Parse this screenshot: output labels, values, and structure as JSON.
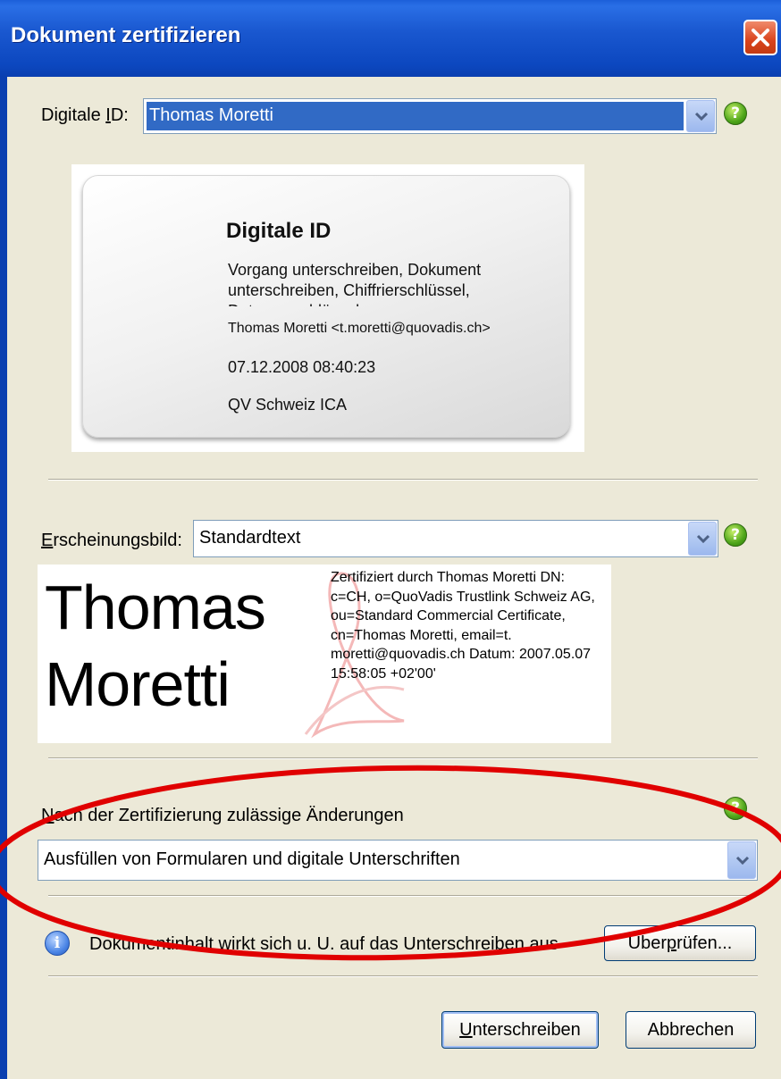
{
  "window": {
    "title": "Dokument zertifizieren"
  },
  "digital_id": {
    "label_pre": "Digitale ",
    "label_accel": "I",
    "label_post": "D:",
    "selected": "Thomas Moretti"
  },
  "id_card": {
    "title": "Digitale ID",
    "usage": "Vorgang unterschreiben, Dokument unterschreiben, Chiffrierschlüssel, Datenverschlüsselung",
    "owner": "Thomas Moretti <t.moretti@quovadis.ch>",
    "date": "07.12.2008 08:40:23",
    "issuer": "QV Schweiz ICA"
  },
  "appearance": {
    "label_accel": "E",
    "label_rest": "rscheinungsbild:",
    "selected": "Standardtext",
    "preview_name_line1": "Thomas",
    "preview_name_line2": "Moretti",
    "preview_details": "Zertifiziert durch Thomas Moretti DN: c=CH, o=QuoVadis Trustlink Schweiz AG, ou=Standard Commercial Certificate, cn=Thomas Moretti, email=t. moretti@quovadis.ch Datum: 2007.05.07 15:58:05 +02'00'"
  },
  "permissions": {
    "label_accel": "N",
    "label_rest": "ach der Zertifizierung zulässige Änderungen",
    "selected": "Ausfüllen von Formularen und digitale Unterschriften"
  },
  "info": {
    "text": "Dokumentinhalt wirkt sich u. U. auf das Unterschreiben aus",
    "review_button_pre": "Über",
    "review_button_accel": "p",
    "review_button_post": "rüfen..."
  },
  "buttons": {
    "sign_accel": "U",
    "sign_rest": "nterschreiben",
    "cancel": "Abbrechen"
  },
  "help_glyph": "?",
  "info_glyph": "i",
  "colors": {
    "titlebar": "#0c47bf",
    "selection": "#316ac5",
    "annotation_ellipse": "#e00000"
  }
}
